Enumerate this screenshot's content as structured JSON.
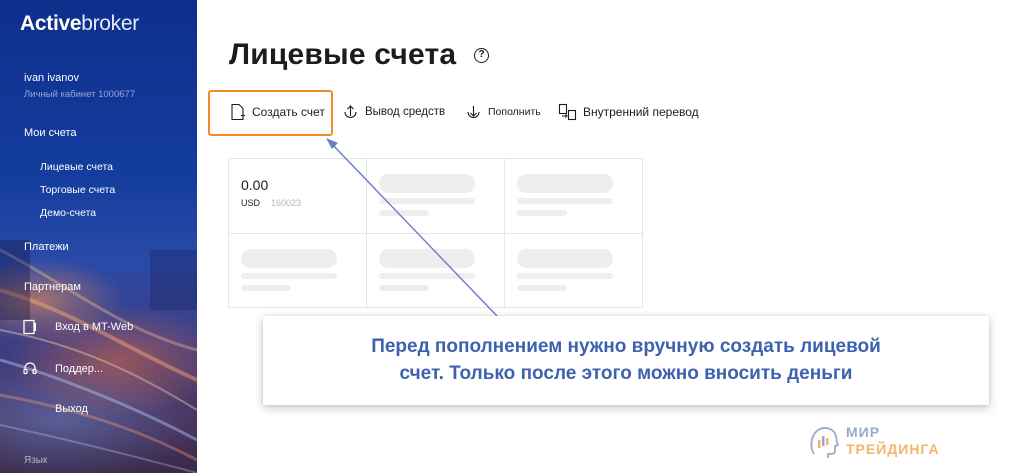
{
  "sidebar": {
    "logo_bold": "Active",
    "logo_light": "broker",
    "user_name": "ivan ivanov",
    "cabinet": "Личный кабинет 1000677",
    "my_accounts": "Мои счета",
    "sub_items": [
      "Лицевые счета",
      "Торговые счета",
      "Демо-счета"
    ],
    "payments": "Платежи",
    "partners": "Партнерам",
    "mt_web": "Вход в MT-Web",
    "support": "Поддер...",
    "logout": "Выход",
    "language": "Язык"
  },
  "page": {
    "title": "Лицевые счета",
    "help": "?"
  },
  "toolbar": {
    "create": "Создать счет",
    "withdraw": "Вывод средств",
    "deposit": "Пополнить",
    "transfer": "Внутренний перевод"
  },
  "account_card": {
    "amount": "0.00",
    "currency": "USD",
    "number": "160023"
  },
  "callout": {
    "line1": "Перед пополнением нужно вручную создать лицевой",
    "line2": "счет. Только после этого можно вносить деньги"
  },
  "watermark": {
    "line1": "МИР",
    "line2": "ТРЕЙДИНГА"
  },
  "colors": {
    "highlight": "#f28c28",
    "callout_text": "#3e62b0",
    "sidebar_top": "#0e2f8c"
  }
}
